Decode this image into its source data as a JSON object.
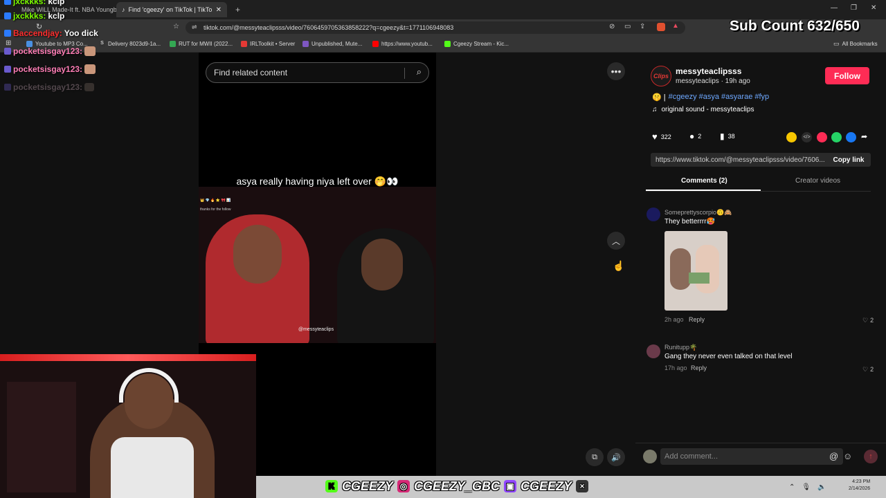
{
  "browser": {
    "tabs": [
      {
        "label": "Mike WiLL Made-It ft. NBA Youngbo",
        "active": false
      },
      {
        "label": "Find 'cgeezy' on TikTok | TikTo",
        "active": true
      }
    ],
    "new_tab": "+",
    "url": "tiktok.com/@messyteaclipsss/video/7606459705363858222?q=cgeezy&t=1771106948083",
    "bookmarks": [
      "Youtube to MP3 Co...",
      "Delivery 8023d9-1a...",
      "RUT for MWII (2022...",
      "IRLToolkit • Server",
      "Unpublished, Mute...",
      "https://www.youtub...",
      "Cgeezy Stream - Kic..."
    ],
    "all_bookmarks": "All Bookmarks"
  },
  "overlay": {
    "sub_count": "Sub Count 632/650",
    "chat": [
      {
        "user": "jxckkks:",
        "msg": "kclp",
        "color": "#7cfc00"
      },
      {
        "user": "jxckkks:",
        "msg": "kclp",
        "color": "#7cfc00"
      },
      {
        "user": "Baccendjay:",
        "msg": "Yoo dick",
        "color": "#ff2d2d"
      },
      {
        "user": "pocketsisgay123:",
        "msg": "",
        "color": "#ff7eb6"
      },
      {
        "user": "pocketsisgay123:",
        "msg": "",
        "color": "#ff7eb6"
      },
      {
        "user": "pocketsisgay123:",
        "msg": "",
        "color": "#5a4a55"
      }
    ],
    "socials": [
      "CGEEZY",
      "CGEEZY_GBC",
      "CGEEZY"
    ]
  },
  "video": {
    "search_placeholder": "Find related content",
    "caption": "asya really having niya left over 🤭👀",
    "watermark": "@messyteaclips",
    "tiny_text": "thanks for the follow"
  },
  "post": {
    "username": "messyteaclipsss",
    "display": "messyteaclips · 19h ago",
    "follow": "Follow",
    "description_prefix": "🤫 |",
    "hashtags": "#cgeezy #asya #asyarae #fyp",
    "sound": "original sound - messyteaclips",
    "likes": "322",
    "comments_count": "2",
    "saves": "38",
    "link": "https://www.tiktok.com/@messyteaclipsss/video/7606...",
    "copy_link": "Copy link",
    "tab_comments": "Comments (2)",
    "tab_creator": "Creator videos"
  },
  "comments": [
    {
      "name": "Someprettyscorpio🙃🙈",
      "text": "They betterrrr🥵",
      "time": "2h ago",
      "reply": "Reply",
      "likes": "2"
    },
    {
      "name": "Runitupp🌴",
      "text": "Gang they never even talked on that level",
      "time": "17h ago",
      "reply": "Reply",
      "likes": "2"
    }
  ],
  "comment_input": {
    "placeholder": "Add comment..."
  },
  "taskbar": {
    "time": "4:23 PM",
    "date": "2/14/2026"
  },
  "colors": {
    "accent": "#fe2c55",
    "hashtag": "#6ea8ff"
  }
}
